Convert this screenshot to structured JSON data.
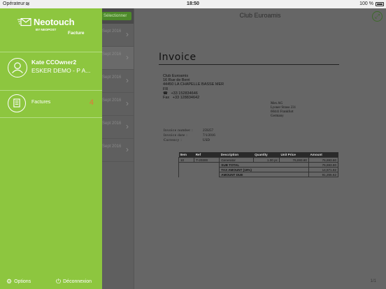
{
  "status": {
    "carrier": "Opérateur",
    "time": "18:50",
    "battery": "100 %"
  },
  "drawer": {
    "brand": "Neotouch",
    "brand_by": "BY NEOPOST",
    "product": "Facture",
    "user_name": "Kate CCOwner2",
    "user_org": "ESKER DEMO - P A...",
    "menu_factures": "Factures",
    "menu_factures_count": "4",
    "options": "Options",
    "logout": "Déconnexion"
  },
  "list": {
    "selection_button": "Sélectionner",
    "rows": [
      {
        "date": "Sept 2016"
      },
      {
        "date": "Sept 2016"
      },
      {
        "date": "Sept 2016"
      },
      {
        "date": "Sept 2016"
      },
      {
        "date": "Sept 2016"
      },
      {
        "date": "Sept 2016"
      }
    ]
  },
  "document": {
    "window_title": "Club Euroamis",
    "page_indicator": "1/1",
    "invoice_title": "Invoice",
    "sender": {
      "name": "Club Euroamis",
      "street": "16 Rue de Berri",
      "city": "44450 LA CHAPELLE BASSE MER",
      "country": "FR",
      "phone": "+33 152834646",
      "fax": "+33 128834642",
      "fax_label": "Fax"
    },
    "recipient": {
      "name": "Mex AG",
      "street": "Lyoner Strass 231",
      "city": "60441 Frankfurt",
      "country": "Germany"
    },
    "meta": {
      "number_label": "Invoice number :",
      "number": "259257",
      "date_label": "Invoice date :",
      "date": "7/1/2016",
      "currency_label": "Currency :",
      "currency": "USD"
    },
    "table": {
      "headers": {
        "item": "Item",
        "ref": "Ref",
        "description": "Description",
        "quantity": "Quantity",
        "unit_price": "Unit Price",
        "amount": "Amount"
      },
      "row": {
        "item": "10",
        "ref": "T-20300",
        "description": "Generator",
        "quantity": "1.00 pc",
        "unit_price": "76,693.80",
        "amount": "76,693.80"
      },
      "sub_total_label": "SUB TOTAL",
      "sub_total": "76,693.80",
      "tax_label": "TAX AMOUNT (19%)",
      "tax": "14,571.82",
      "due_label": "AMOUNT DUE",
      "due": "91,265.62"
    }
  }
}
